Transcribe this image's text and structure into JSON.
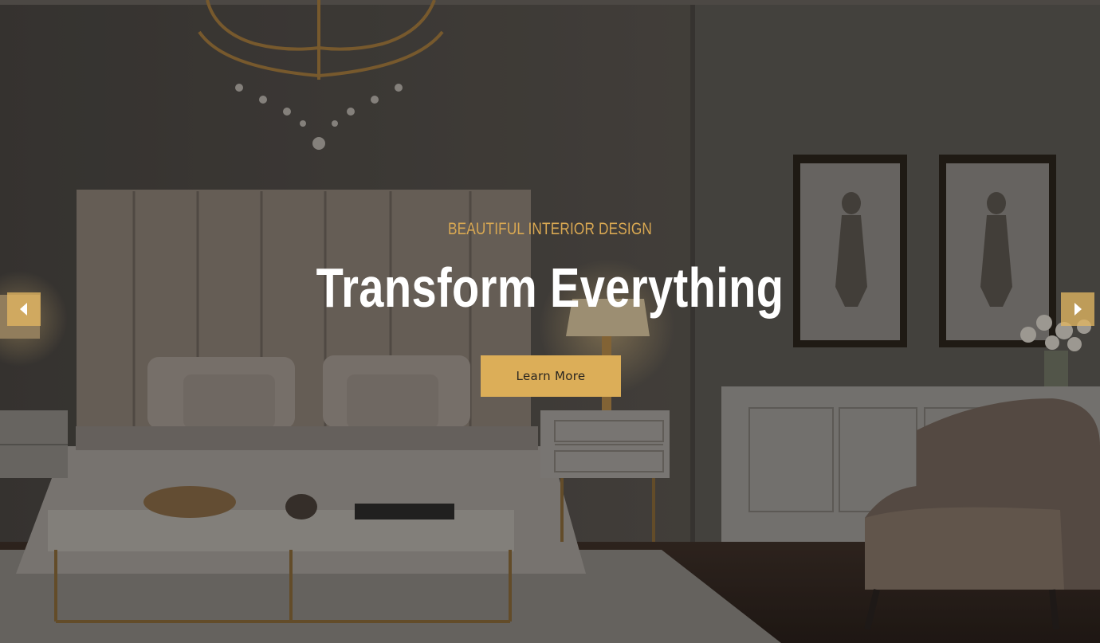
{
  "hero": {
    "eyebrow": "BEAUTIFUL INTERIOR DESIGN",
    "headline": "Transform Everything",
    "cta_label": "Learn More"
  },
  "slider": {
    "prev_icon": "chevron-left-icon",
    "next_icon": "chevron-right-icon"
  },
  "colors": {
    "accent": "#dcae58",
    "headline": "#ffffff",
    "eyebrow": "#d9a852"
  }
}
